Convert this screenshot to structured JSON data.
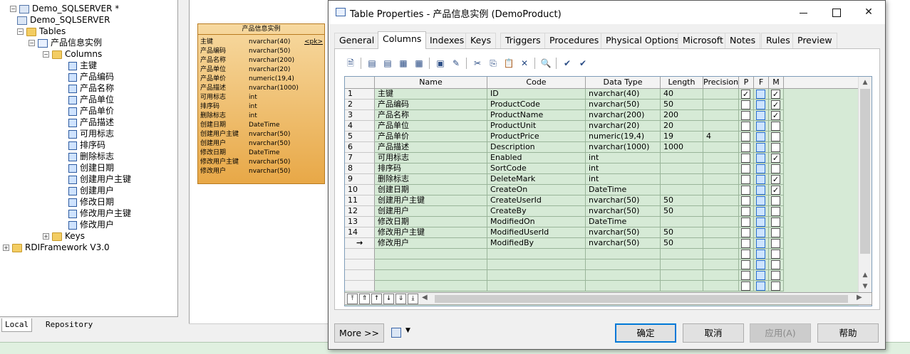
{
  "browser": {
    "items": [
      {
        "label": "Demo_SQLSERVER *",
        "level": 1,
        "icon": "model"
      },
      {
        "label": "Demo_SQLSERVER",
        "level": 2,
        "icon": "model"
      },
      {
        "label": "Tables",
        "level": 2,
        "icon": "folder"
      },
      {
        "label": "产品信息实例",
        "level": 3,
        "icon": "table"
      },
      {
        "label": "Columns",
        "level": 4,
        "icon": "folder"
      },
      {
        "label": "主键",
        "level": 5,
        "icon": "col"
      },
      {
        "label": "产品编码",
        "level": 5,
        "icon": "col"
      },
      {
        "label": "产品名称",
        "level": 5,
        "icon": "col"
      },
      {
        "label": "产品单位",
        "level": 5,
        "icon": "col"
      },
      {
        "label": "产品单价",
        "level": 5,
        "icon": "col"
      },
      {
        "label": "产品描述",
        "level": 5,
        "icon": "col"
      },
      {
        "label": "可用标志",
        "level": 5,
        "icon": "col"
      },
      {
        "label": "排序码",
        "level": 5,
        "icon": "col"
      },
      {
        "label": "删除标志",
        "level": 5,
        "icon": "col"
      },
      {
        "label": "创建日期",
        "level": 5,
        "icon": "col"
      },
      {
        "label": "创建用户主键",
        "level": 5,
        "icon": "col"
      },
      {
        "label": "创建用户",
        "level": 5,
        "icon": "col"
      },
      {
        "label": "修改日期",
        "level": 5,
        "icon": "col"
      },
      {
        "label": "修改用户主键",
        "level": 5,
        "icon": "col"
      },
      {
        "label": "修改用户",
        "level": 5,
        "icon": "col"
      },
      {
        "label": "Keys",
        "level": 4,
        "icon": "folder"
      },
      {
        "label": "RDIFramework V3.0",
        "level": 0,
        "icon": "folder"
      }
    ],
    "tab_local": "Local",
    "tab_repository": "Repository"
  },
  "entity": {
    "title": "产品信息实例",
    "pk_tag": "<pk>",
    "rows": [
      {
        "name": "主键",
        "type": "nvarchar(40)"
      },
      {
        "name": "产品编码",
        "type": "nvarchar(50)"
      },
      {
        "name": "产品名称",
        "type": "nvarchar(200)"
      },
      {
        "name": "产品单位",
        "type": "nvarchar(20)"
      },
      {
        "name": "产品单价",
        "type": "numeric(19,4)"
      },
      {
        "name": "产品描述",
        "type": "nvarchar(1000)"
      },
      {
        "name": "可用标志",
        "type": "int"
      },
      {
        "name": "排序码",
        "type": "int"
      },
      {
        "name": "删除标志",
        "type": "int"
      },
      {
        "name": "创建日期",
        "type": "DateTime"
      },
      {
        "name": "创建用户主键",
        "type": "nvarchar(50)"
      },
      {
        "name": "创建用户",
        "type": "nvarchar(50)"
      },
      {
        "name": "修改日期",
        "type": "DateTime"
      },
      {
        "name": "修改用户主键",
        "type": "nvarchar(50)"
      },
      {
        "name": "修改用户",
        "type": "nvarchar(50)"
      }
    ]
  },
  "dialog": {
    "title": "Table Properties - 产品信息实例 (DemoProduct)",
    "tabs": [
      "General",
      "Columns",
      "Indexes",
      "Keys",
      "Triggers",
      "Procedures",
      "Physical Options",
      "Microsoft",
      "Notes",
      "Rules",
      "Preview"
    ],
    "active_tab": "Columns",
    "columns": [
      "Name",
      "Code",
      "Data Type",
      "Length",
      "Precision",
      "P",
      "F",
      "M"
    ],
    "rows": [
      {
        "num": "1",
        "name": "主键",
        "code": "ID",
        "type": "nvarchar(40)",
        "length": "40",
        "precision": "",
        "p": true,
        "f": false,
        "m": true
      },
      {
        "num": "2",
        "name": "产品编码",
        "code": "ProductCode",
        "type": "nvarchar(50)",
        "length": "50",
        "precision": "",
        "p": false,
        "f": false,
        "m": true
      },
      {
        "num": "3",
        "name": "产品名称",
        "code": "ProductName",
        "type": "nvarchar(200)",
        "length": "200",
        "precision": "",
        "p": false,
        "f": false,
        "m": true
      },
      {
        "num": "4",
        "name": "产品单位",
        "code": "ProductUnit",
        "type": "nvarchar(20)",
        "length": "20",
        "precision": "",
        "p": false,
        "f": false,
        "m": false
      },
      {
        "num": "5",
        "name": "产品单价",
        "code": "ProductPrice",
        "type": "numeric(19,4)",
        "length": "19",
        "precision": "4",
        "p": false,
        "f": false,
        "m": false
      },
      {
        "num": "6",
        "name": "产品描述",
        "code": "Description",
        "type": "nvarchar(1000)",
        "length": "1000",
        "precision": "",
        "p": false,
        "f": false,
        "m": false
      },
      {
        "num": "7",
        "name": "可用标志",
        "code": "Enabled",
        "type": "int",
        "length": "",
        "precision": "",
        "p": false,
        "f": false,
        "m": true
      },
      {
        "num": "8",
        "name": "排序码",
        "code": "SortCode",
        "type": "int",
        "length": "",
        "precision": "",
        "p": false,
        "f": false,
        "m": false
      },
      {
        "num": "9",
        "name": "删除标志",
        "code": "DeleteMark",
        "type": "int",
        "length": "",
        "precision": "",
        "p": false,
        "f": false,
        "m": true
      },
      {
        "num": "10",
        "name": "创建日期",
        "code": "CreateOn",
        "type": "DateTime",
        "length": "",
        "precision": "",
        "p": false,
        "f": false,
        "m": true
      },
      {
        "num": "11",
        "name": "创建用户主键",
        "code": "CreateUserId",
        "type": "nvarchar(50)",
        "length": "50",
        "precision": "",
        "p": false,
        "f": false,
        "m": false
      },
      {
        "num": "12",
        "name": "创建用户",
        "code": "CreateBy",
        "type": "nvarchar(50)",
        "length": "50",
        "precision": "",
        "p": false,
        "f": false,
        "m": false
      },
      {
        "num": "13",
        "name": "修改日期",
        "code": "ModifiedOn",
        "type": "DateTime",
        "length": "",
        "precision": "",
        "p": false,
        "f": false,
        "m": false
      },
      {
        "num": "14",
        "name": "修改用户主键",
        "code": "ModifiedUserId",
        "type": "nvarchar(50)",
        "length": "50",
        "precision": "",
        "p": false,
        "f": false,
        "m": false
      },
      {
        "num": "→",
        "name": "修改用户",
        "code": "ModifiedBy",
        "type": "nvarchar(50)",
        "length": "50",
        "precision": "",
        "p": false,
        "f": false,
        "m": false
      }
    ],
    "empty_rows": 4,
    "buttons": {
      "more": "More >>",
      "ok": "确定",
      "cancel": "取消",
      "apply": "应用(A)",
      "help": "帮助"
    }
  },
  "colors": {
    "grid_bg": "#d6ead6",
    "entity_top": "#f7d9a0",
    "entity_bottom": "#e8a847",
    "accent": "#0078d7"
  }
}
